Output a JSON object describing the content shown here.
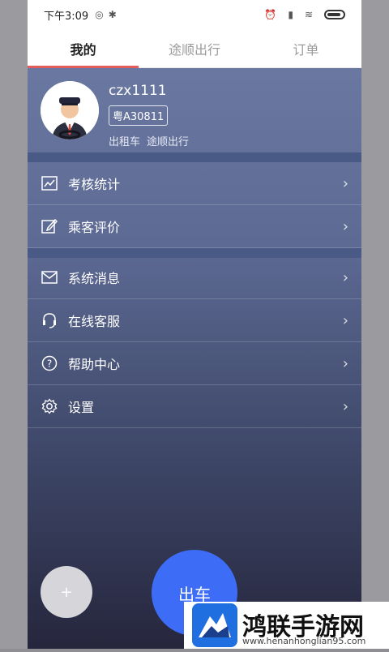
{
  "status": {
    "time": "下午3:09"
  },
  "tabs": [
    {
      "label": "我的",
      "active": true
    },
    {
      "label": "途顺出行",
      "active": false
    },
    {
      "label": "订单",
      "active": false
    }
  ],
  "profile": {
    "username": "czx1111",
    "plate": "粤A30811",
    "roles": [
      "出租车",
      "途顺出行"
    ]
  },
  "menu_group_1": [
    {
      "label": "考核统计",
      "icon": "chart-icon"
    },
    {
      "label": "乘客评价",
      "icon": "edit-icon"
    }
  ],
  "menu_group_2": [
    {
      "label": "系统消息",
      "icon": "mail-icon"
    },
    {
      "label": "在线客服",
      "icon": "headset-icon"
    },
    {
      "label": "帮助中心",
      "icon": "help-icon"
    },
    {
      "label": "设置",
      "icon": "gear-icon"
    }
  ],
  "buttons": {
    "plus": "+",
    "go": "出车"
  },
  "watermark": {
    "name": "鸿联手游网",
    "url": "www.henanhonglian95.com"
  },
  "colors": {
    "accent_red": "#e35d5b",
    "primary_blue": "#3d6cf7"
  }
}
